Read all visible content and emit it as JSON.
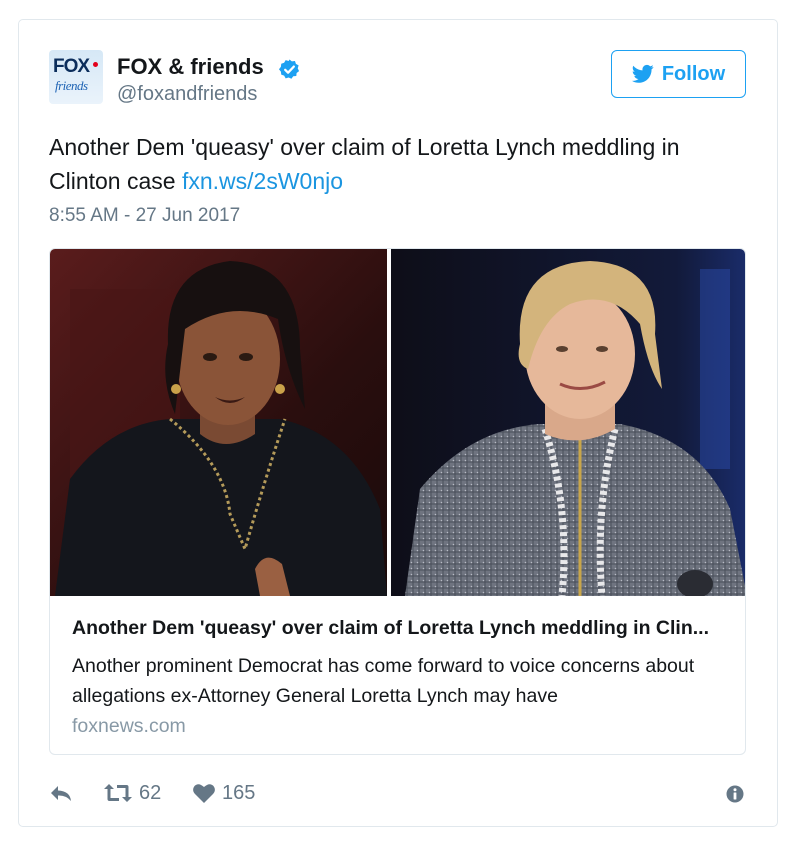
{
  "author": {
    "display_name": "FOX & friends",
    "handle": "@foxandfriends",
    "avatar_text_top": "FOX",
    "avatar_text_bottom": "friends",
    "verified": true
  },
  "follow_button": {
    "label": "Follow",
    "icon": "twitter-bird-icon"
  },
  "tweet": {
    "text": "Another Dem 'queasy' over claim of Loretta Lynch meddling in Clinton case",
    "link": "fxn.ws/2sW0njo",
    "timestamp": "8:55 AM - 27 Jun 2017"
  },
  "card": {
    "title": "Another Dem 'queasy' over claim of Loretta Lynch meddling in Clin...",
    "description": "Another prominent Democrat has come forward to voice concerns about allegations ex-Attorney General Loretta Lynch may have",
    "domain": "foxnews.com"
  },
  "actions": {
    "reply_icon": "reply-icon",
    "retweet_icon": "retweet-icon",
    "retweet_count": "62",
    "like_icon": "heart-icon",
    "like_count": "165",
    "info_icon": "info-icon"
  },
  "colors": {
    "accent": "#1da1f2",
    "link": "#1b95e0",
    "muted": "#657786",
    "border": "#e1e8ed"
  }
}
